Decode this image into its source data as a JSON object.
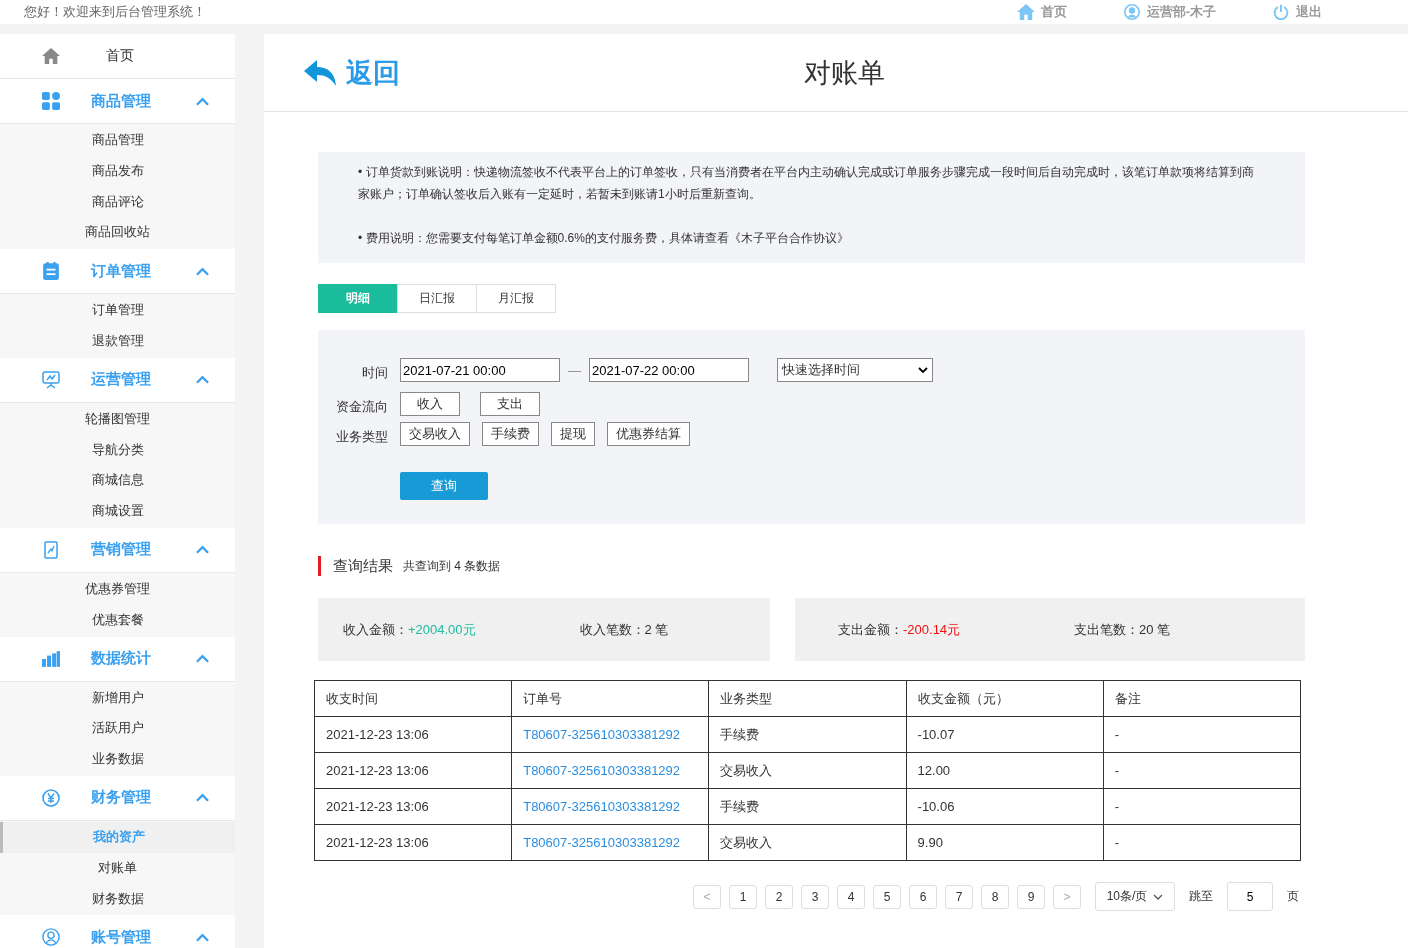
{
  "topbar": {
    "greeting": "您好！欢迎来到后台管理系统！",
    "links": [
      {
        "kind": "home",
        "label": "首页"
      },
      {
        "kind": "user",
        "label": "运营部-木子"
      },
      {
        "kind": "logout",
        "label": "退出"
      }
    ]
  },
  "sidebar": {
    "home": {
      "label": "首页"
    },
    "groups": [
      {
        "kind": "grid",
        "label": "商品管理",
        "expanded": true,
        "items": [
          {
            "label": "商品管理",
            "selected": false
          },
          {
            "label": "商品发布",
            "selected": false
          },
          {
            "label": "商品评论",
            "selected": false
          },
          {
            "label": "商品回收站",
            "selected": false
          }
        ]
      },
      {
        "kind": "doc",
        "label": "订单管理",
        "expanded": true,
        "items": [
          {
            "label": "订单管理",
            "selected": false
          },
          {
            "label": "退款管理",
            "selected": false
          }
        ]
      },
      {
        "kind": "screen",
        "label": "运营管理",
        "expanded": true,
        "items": [
          {
            "label": "轮播图管理",
            "selected": false
          },
          {
            "label": "导航分类",
            "selected": false
          },
          {
            "label": "商城信息",
            "selected": false
          },
          {
            "label": "商城设置",
            "selected": false
          }
        ]
      },
      {
        "kind": "tablet",
        "label": "营销管理",
        "expanded": true,
        "items": [
          {
            "label": "优惠券管理",
            "selected": false
          },
          {
            "label": "优惠套餐",
            "selected": false
          }
        ]
      },
      {
        "kind": "bars",
        "label": "数据统计",
        "expanded": true,
        "items": [
          {
            "label": "新增用户",
            "selected": false
          },
          {
            "label": "活跃用户",
            "selected": false
          },
          {
            "label": "业务数据",
            "selected": false
          }
        ]
      },
      {
        "kind": "yen",
        "label": "财务管理",
        "expanded": true,
        "items": [
          {
            "label": "我的资产",
            "selected": true
          },
          {
            "label": "对账单",
            "selected": false
          },
          {
            "label": "财务数据",
            "selected": false
          }
        ]
      },
      {
        "kind": "user",
        "label": "账号管理",
        "expanded": true
      }
    ]
  },
  "header": {
    "back": "返回",
    "title": "对账单"
  },
  "notice": [
    "• 订单货款到账说明：快递物流签收不代表平台上的订单签收，只有当消费者在平台内主动确认完成或订单服务步骤完成一段时间后自动完成时，该笔订单款项将结算到商家账户；订单确认签收后入账有一定延时，若暂未到账请1小时后重新查询。",
    "• 费用说明：您需要支付每笔订单金额0.6%的支付服务费，具体请查看《木子平台合作协议》"
  ],
  "tabs": [
    {
      "label": "明细",
      "selected": true
    },
    {
      "label": "日汇报",
      "selected": false
    },
    {
      "label": "月汇报",
      "selected": false
    }
  ],
  "filter": {
    "time_label": "时间",
    "start": "2021-07-21 00:00",
    "separator": "—",
    "end": "2021-07-22 00:00",
    "quick_select": "快速选择时间",
    "flow_label": "资金流向",
    "flow_options": [
      "收入",
      "支出"
    ],
    "type_label": "业务类型",
    "type_options": [
      "交易收入",
      "手续费",
      "提现",
      "优惠券结算"
    ],
    "query_button": "查询"
  },
  "result": {
    "title": "查询结果",
    "count": "共查询到 4 条数据"
  },
  "summary": [
    {
      "kind": "income",
      "items": [
        {
          "label": "收入金额：",
          "value": "+2004.00元"
        },
        {
          "label": "收入笔数：",
          "value": "2 笔"
        }
      ]
    },
    {
      "kind": "expense",
      "items": [
        {
          "label": "支出金额：",
          "value": "-200.14元"
        },
        {
          "label": "支出笔数：",
          "value": "20 笔"
        }
      ]
    }
  ],
  "table": {
    "columns": [
      "收支时间",
      "订单号",
      "业务类型",
      "收支金额（元）",
      "备注"
    ],
    "rows": [
      [
        "2021-12-23 13:06",
        "T80607-325610303381292",
        "手续费",
        "-10.07",
        "-"
      ],
      [
        "2021-12-23 13:06",
        "T80607-325610303381292",
        "交易收入",
        "12.00",
        "-"
      ],
      [
        "2021-12-23 13:06",
        "T80607-325610303381292",
        "手续费",
        "-10.06",
        "-"
      ],
      [
        "2021-12-23 13:06",
        "T80607-325610303381292",
        "交易收入",
        "9.90",
        "-"
      ]
    ]
  },
  "pagination": {
    "prev": "<",
    "pages": [
      {
        "label": "1",
        "selected": false
      },
      {
        "label": "2",
        "selected": false
      },
      {
        "label": "3",
        "selected": false
      },
      {
        "label": "4",
        "selected": false
      },
      {
        "label": "5",
        "selected": false
      },
      {
        "label": "6",
        "selected": false
      },
      {
        "label": "7",
        "selected": false
      },
      {
        "label": "8",
        "selected": false
      },
      {
        "label": "9",
        "selected": false
      }
    ],
    "next": ">",
    "page_size": "10条/页",
    "jump_label": "跳至",
    "jump_value": "5",
    "page_suffix": "页"
  }
}
